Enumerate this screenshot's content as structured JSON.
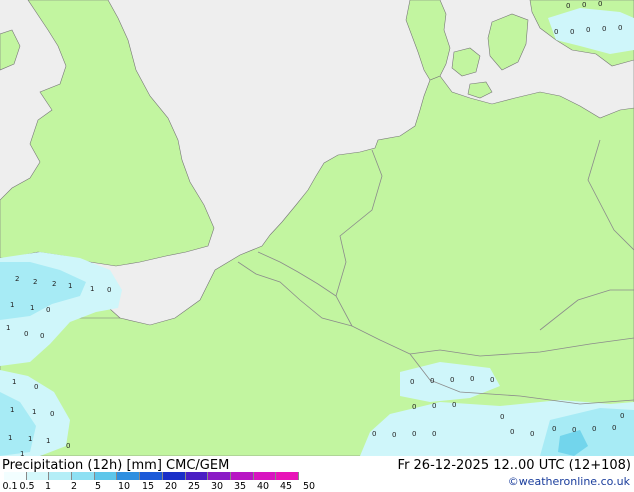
{
  "title": {
    "product": "Precipitation (12h) [mm] CMC/GEM",
    "valid": "Fr 26-12-2025 12..00 UTC (12+108)",
    "credit": "©weatheronline.co.uk"
  },
  "colors": {
    "sea": "#eeeeee",
    "land": "#c2f5a0",
    "border": "#8b8b8b",
    "precip_light": "#cff6fa",
    "precip_mid": "#a7ebf5",
    "precip_heavy": "#72d5ec"
  },
  "legend": {
    "ticks": [
      "0.1",
      "0.5",
      "1",
      "2",
      "5",
      "10",
      "15",
      "20",
      "25",
      "30",
      "35",
      "40",
      "45",
      "50"
    ],
    "colors": [
      "#f2feff",
      "#d4f8fb",
      "#b4eef7",
      "#8ee0f3",
      "#5ec6ea",
      "#2f8fe0",
      "#1c5ad8",
      "#1a2fc8",
      "#4a1fc4",
      "#8a1bc6",
      "#b816c4",
      "#d814c0",
      "#e814b8"
    ]
  },
  "point_values": [
    {
      "v": "2"
    },
    {
      "v": "2"
    },
    {
      "v": "2"
    },
    {
      "v": "1"
    },
    {
      "v": "1"
    },
    {
      "v": "0"
    },
    {
      "v": "1"
    },
    {
      "v": "1"
    },
    {
      "v": "0"
    },
    {
      "v": "1"
    },
    {
      "v": "0"
    },
    {
      "v": "0"
    },
    {
      "v": "1"
    },
    {
      "v": "0"
    },
    {
      "v": "1"
    },
    {
      "v": "1"
    },
    {
      "v": "0"
    },
    {
      "v": "1"
    },
    {
      "v": "1"
    },
    {
      "v": "1"
    },
    {
      "v": "0"
    },
    {
      "v": "1"
    },
    {
      "v": "0"
    },
    {
      "v": "0"
    },
    {
      "v": "0"
    },
    {
      "v": "0"
    },
    {
      "v": "0"
    },
    {
      "v": "0"
    },
    {
      "v": "0"
    },
    {
      "v": "0"
    },
    {
      "v": "0"
    },
    {
      "v": "0"
    },
    {
      "v": "0"
    },
    {
      "v": "0"
    },
    {
      "v": "0"
    },
    {
      "v": "0"
    },
    {
      "v": "0"
    },
    {
      "v": "0"
    },
    {
      "v": "0"
    },
    {
      "v": "0"
    },
    {
      "v": "0"
    },
    {
      "v": "0"
    },
    {
      "v": "0"
    },
    {
      "v": "0"
    },
    {
      "v": "0"
    },
    {
      "v": "0"
    },
    {
      "v": "0"
    },
    {
      "v": "0"
    },
    {
      "v": "0"
    },
    {
      "v": "0"
    }
  ]
}
